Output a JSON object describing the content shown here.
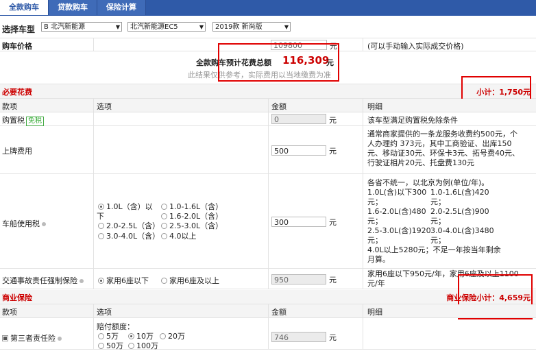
{
  "tabs": [
    "全款购车",
    "贷款购车",
    "保险计算"
  ],
  "selector": {
    "label": "选择车型",
    "brand": "B 北汽新能源",
    "series": "北汽新能源EC5",
    "model": "2019款 新尚版"
  },
  "price": {
    "label": "购车价格",
    "value": "109800",
    "unit": "元",
    "note": "(可以手动输入实际成交价格)"
  },
  "total": {
    "label": "全款购车预计花费总额",
    "value": "116,309",
    "unit": "元",
    "note": "此结果仅供参考，实际费用以当地缴费为准"
  },
  "required": {
    "title": "必要花费",
    "subtotal": "小计：1,750元",
    "headers": [
      "款项",
      "选项",
      "金额",
      "明细"
    ],
    "purchase_tax": {
      "label": "购置税",
      "badge": "免税",
      "value": "0",
      "unit": "元",
      "detail": "该车型满足购置税免除条件"
    },
    "plate": {
      "label": "上牌费用",
      "value": "500",
      "unit": "元",
      "detail": [
        "通常商家提供的一条龙服务收费约500元，个",
        "人办理约 373元，其中工商验证、出库150",
        "元、移动证30元、环保卡3元、拓号费40元、",
        "行驶证相片20元、托盘费130元"
      ]
    },
    "vessel_tax": {
      "label": "车船使用税",
      "options": [
        "1.0L（含）以",
        "下",
        "1.0-1.6L（含）",
        "1.6-2.0L（含）",
        "2.0-2.5L（含）",
        "2.5-3.0L（含）",
        "3.0-4.0L（含）",
        "4.0以上"
      ],
      "value": "300",
      "unit": "元",
      "detail": [
        "各省不统一，以北京为例(单位/年)。",
        "1.0L(含)以下300",
        "元；",
        "1.0-1.6L(含)420",
        "元；",
        "1.6-2.0L(含)480",
        "元；",
        "2.0-2.5L(含)900",
        "元；",
        "2.5-3.0L(含)1920",
        "元；",
        "3.0-4.0L(含)3480",
        "元；",
        "4.0L以上5280元；不足一年按当年剩余",
        "月算。"
      ]
    },
    "compulsory": {
      "label": "交通事故责任强制保险",
      "options": [
        "家用6座以下",
        "家用6座及以上"
      ],
      "value": "950",
      "unit": "元",
      "detail": [
        "家用6座以下950元/年，家用6座及以上1100",
        "元/年"
      ]
    }
  },
  "commercial": {
    "title": "商业保险",
    "subtotal": "商业保险小计：4,659元",
    "headers": [
      "款项",
      "选项",
      "金额",
      "明细"
    ],
    "third_party": {
      "label": "第三者责任险",
      "limit_label": "赔付额度：",
      "options": [
        "5万",
        "10万",
        "20万",
        "50万",
        "100万"
      ],
      "value": "746",
      "unit": "元"
    }
  },
  "colors": {
    "tab_bg": "#2f5aa8",
    "accent_red": "#cc0000",
    "highlight_box": "#e00000"
  }
}
